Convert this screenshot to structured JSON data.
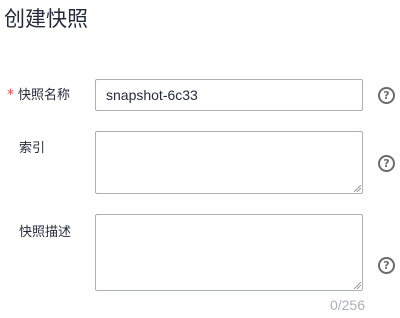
{
  "page": {
    "title": "创建快照"
  },
  "form": {
    "name": {
      "required_mark": "*",
      "label": "快照名称",
      "value": "snapshot-6c33"
    },
    "index": {
      "label": "索引",
      "value": ""
    },
    "description": {
      "label": "快照描述",
      "value": "",
      "counter": "0/256"
    }
  },
  "icons": {
    "help": "question-circle-icon",
    "help_glyph": "?"
  },
  "colors": {
    "text": "#252b3a",
    "required": "#e54545",
    "border": "#adb0b8",
    "help_icon": "#6c6c6c",
    "counter": "#adb0b8"
  }
}
